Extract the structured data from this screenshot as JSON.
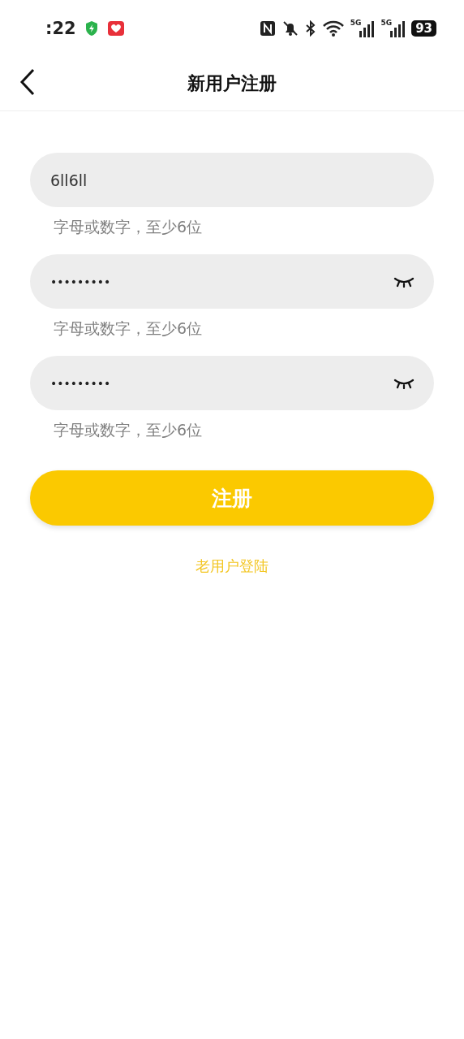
{
  "status_bar": {
    "time": ":22",
    "networks": [
      "5G",
      "5G"
    ],
    "battery": "93"
  },
  "header": {
    "title": "新用户注册"
  },
  "fields": [
    {
      "kind": "text",
      "value": "6ll6ll",
      "hint": "字母或数字，至少6位"
    },
    {
      "kind": "password",
      "value": "•••••••••",
      "hint": "字母或数字，至少6位"
    },
    {
      "kind": "password",
      "value": "•••••••••",
      "hint": "字母或数字，至少6位"
    }
  ],
  "submit_button": "注册",
  "login_link": "老用户登陆"
}
